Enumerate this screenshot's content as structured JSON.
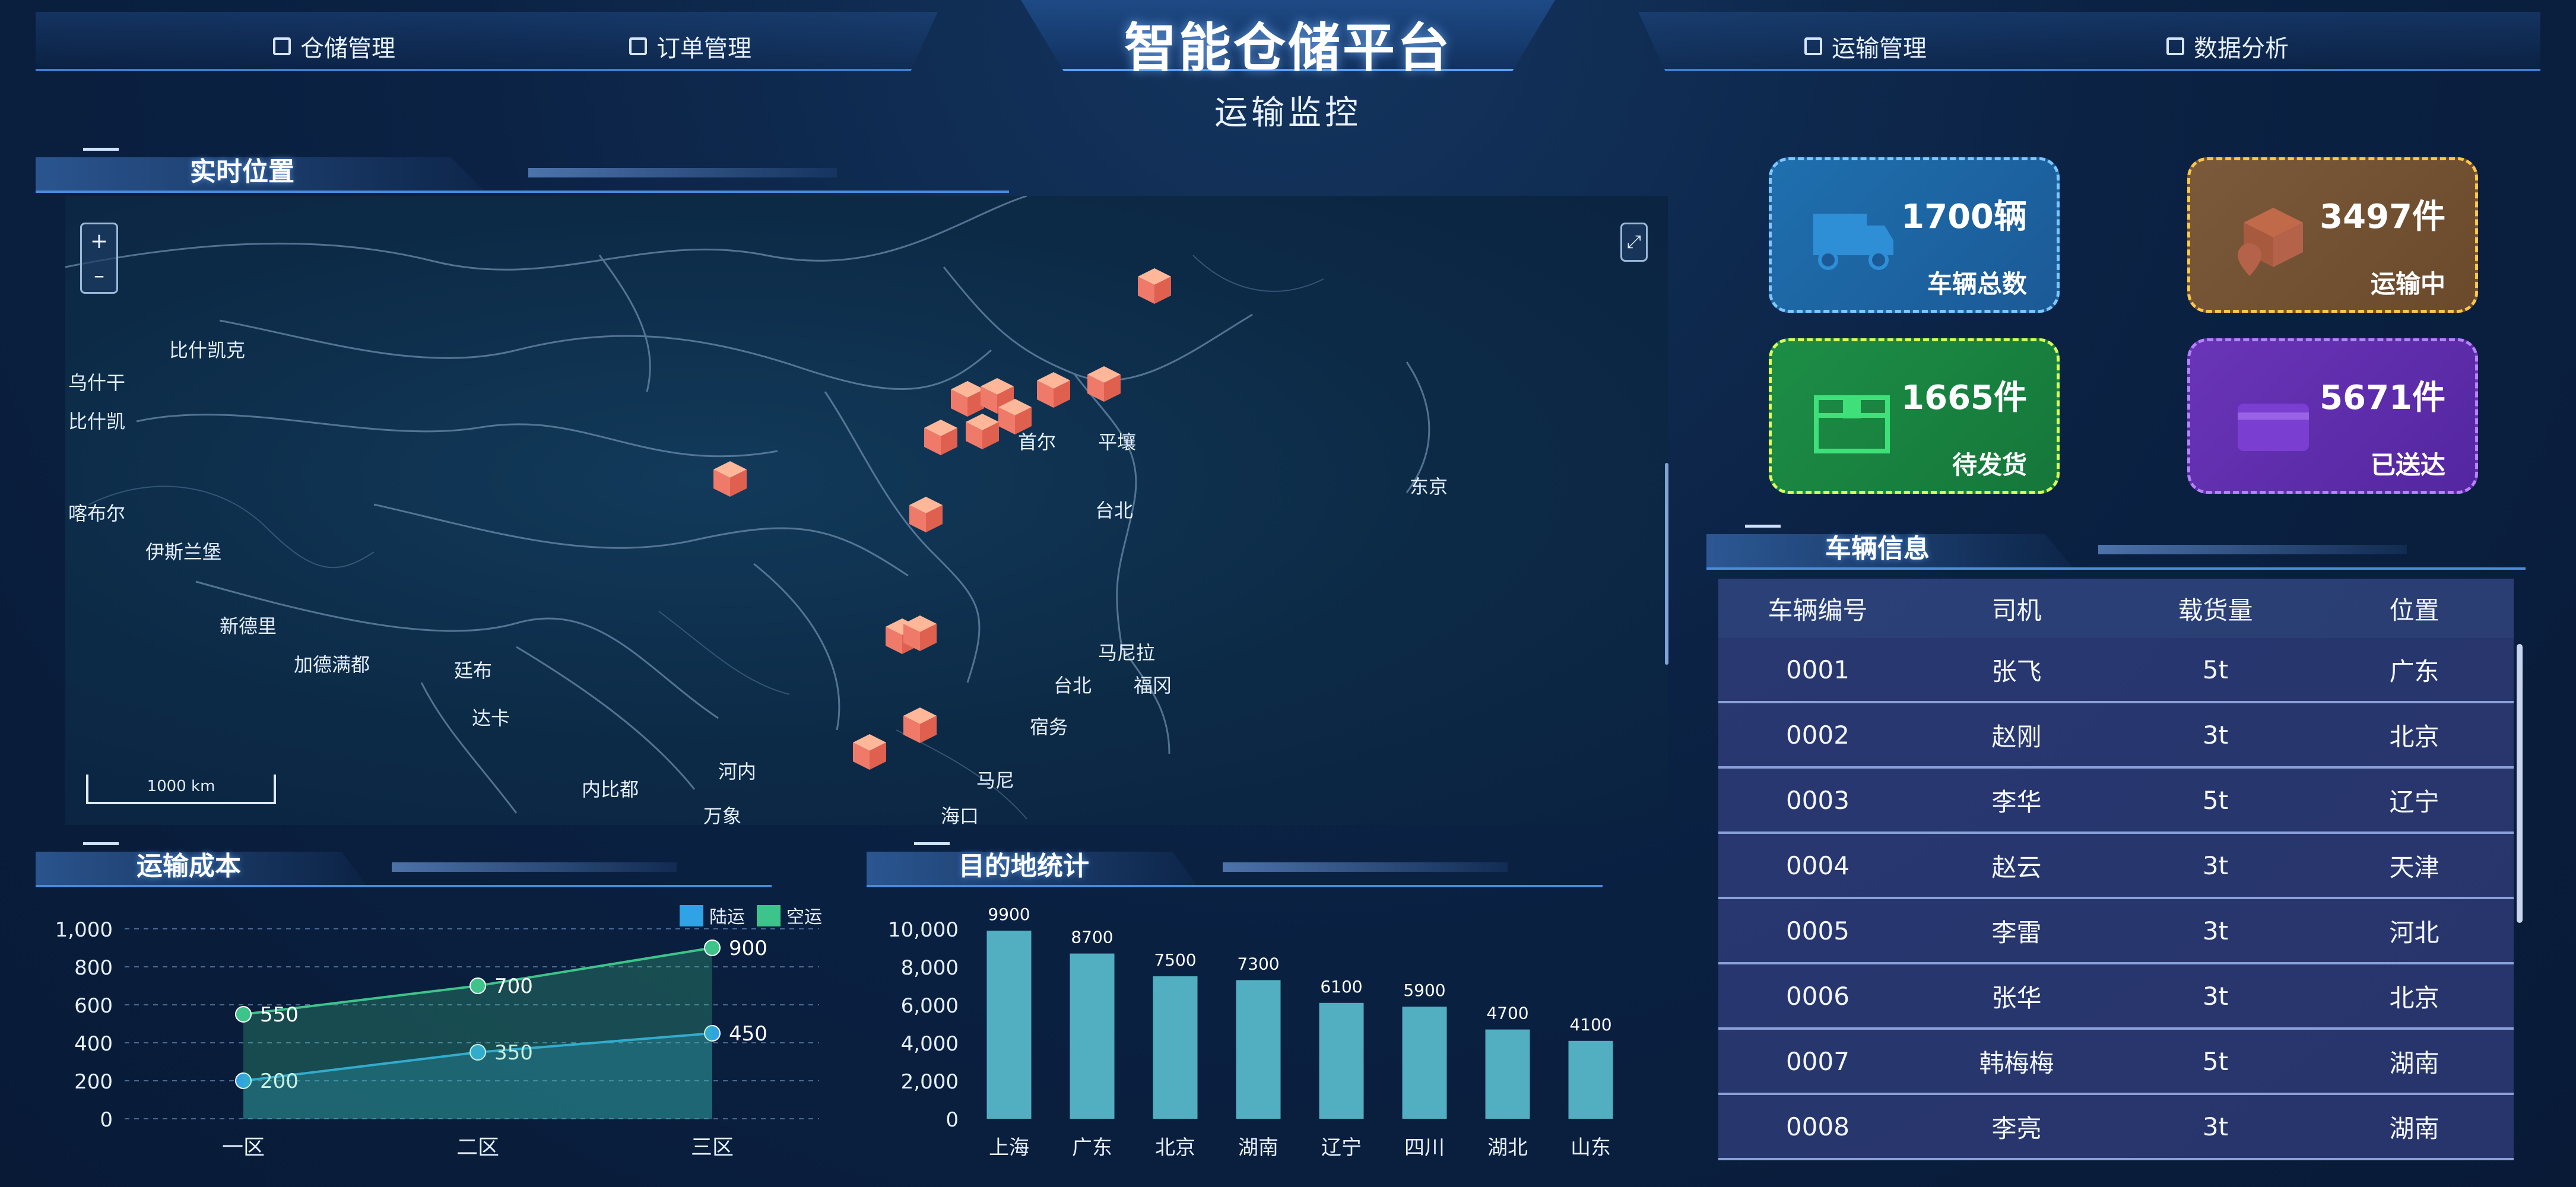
{
  "header": {
    "title": "智能仓储平台",
    "subtitle": "运输监控",
    "nav": [
      {
        "label": "仓储管理",
        "icon": "home-icon"
      },
      {
        "label": "订单管理",
        "icon": "document-icon"
      },
      {
        "label": "运输管理",
        "icon": "truck-icon"
      },
      {
        "label": "数据分析",
        "icon": "bar-chart-icon"
      }
    ]
  },
  "map_section": {
    "title": "实时位置",
    "scale": "1000 km",
    "zoom_in": "+",
    "zoom_out": "–",
    "labels": [
      "比什凯克",
      "乌什干",
      "比什凯",
      "喀布尔",
      "伊斯兰堡",
      "新德里",
      "加德满都",
      "廷布",
      "达卡",
      "内比都",
      "河内",
      "万象",
      "首尔",
      "平壤",
      "东京",
      "台北",
      "马尼拉",
      "福冈",
      "台北",
      "宿务",
      "马尼",
      "海口"
    ]
  },
  "stats": [
    {
      "value": "1700辆",
      "caption": "车辆总数",
      "icon": "truck-icon"
    },
    {
      "value": "3497件",
      "caption": "运输中",
      "icon": "package-location-icon"
    },
    {
      "value": "1665件",
      "caption": "待发货",
      "icon": "box-icon"
    },
    {
      "value": "5671件",
      "caption": "已送达",
      "icon": "wallet-icon"
    }
  ],
  "vehicles": {
    "title": "车辆信息",
    "columns": [
      "车辆编号",
      "司机",
      "载货量",
      "位置"
    ],
    "rows": [
      [
        "0001",
        "张飞",
        "5t",
        "广东"
      ],
      [
        "0002",
        "赵刚",
        "3t",
        "北京"
      ],
      [
        "0003",
        "李华",
        "5t",
        "辽宁"
      ],
      [
        "0004",
        "赵云",
        "3t",
        "天津"
      ],
      [
        "0005",
        "李雷",
        "3t",
        "河北"
      ],
      [
        "0006",
        "张华",
        "3t",
        "北京"
      ],
      [
        "0007",
        "韩梅梅",
        "5t",
        "湖南"
      ],
      [
        "0008",
        "李亮",
        "3t",
        "湖南"
      ]
    ]
  },
  "chart_data": [
    {
      "type": "line",
      "title": "运输成本",
      "categories": [
        "一区",
        "二区",
        "三区"
      ],
      "series": [
        {
          "name": "陆运",
          "values": [
            200,
            350,
            450
          ],
          "color": "#2fa3e6"
        },
        {
          "name": "空运",
          "values": [
            550,
            700,
            900
          ],
          "color": "#3ec48a"
        }
      ],
      "ylim": [
        0,
        1000
      ],
      "yticks": [
        "0",
        "200",
        "400",
        "600",
        "800",
        "1,000"
      ],
      "legend": "top-right",
      "grid": true
    },
    {
      "type": "bar",
      "title": "目的地统计",
      "categories": [
        "上海",
        "广东",
        "北京",
        "湖南",
        "辽宁",
        "四川",
        "湖北",
        "山东"
      ],
      "values": [
        9900,
        8700,
        7500,
        7300,
        6100,
        5900,
        4700,
        4100
      ],
      "ylim": [
        0,
        10000
      ],
      "yticks": [
        "0",
        "2,000",
        "4,000",
        "6,000",
        "8,000",
        "10,000"
      ],
      "color": "#5fc8d8"
    }
  ]
}
